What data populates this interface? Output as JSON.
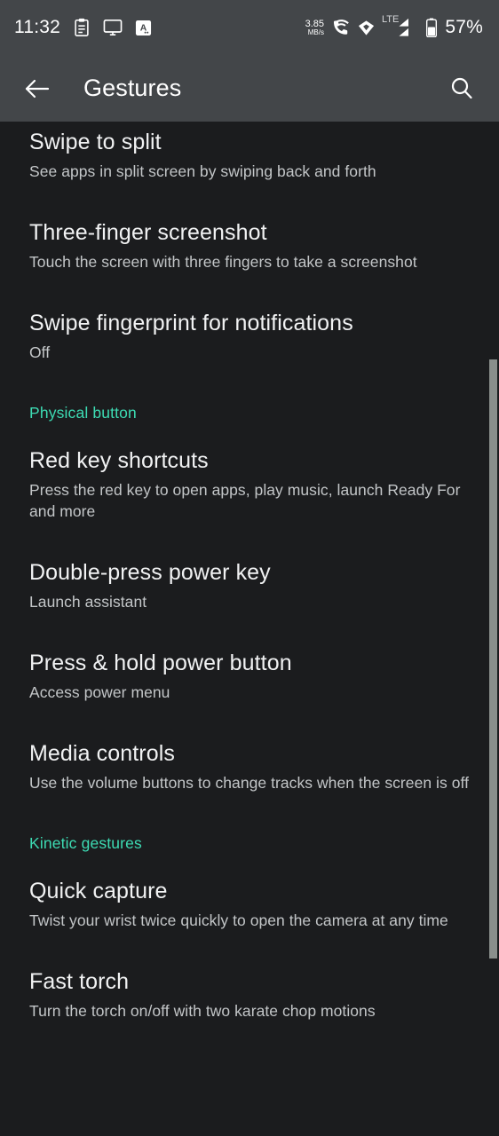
{
  "statusbar": {
    "time": "11:32",
    "icons_left": [
      "clipboard-icon",
      "cast-display-icon",
      "app-badge-a-icon"
    ],
    "network_speed_value": "3.85",
    "network_speed_unit": "MB/s",
    "icons_right": [
      "phone-wifi-calling-icon",
      "vowifi-diamond-icon"
    ],
    "network_type": "LTE",
    "battery_percent": "57%"
  },
  "appbar": {
    "back_icon": "arrow-back-icon",
    "title": "Gestures",
    "search_icon": "search-icon"
  },
  "list": [
    {
      "kind": "item",
      "title": "Swipe to split",
      "subtitle": "See apps in split screen by swiping back and forth"
    },
    {
      "kind": "item",
      "title": "Three-finger screenshot",
      "subtitle": "Touch the screen with three fingers to take a screenshot"
    },
    {
      "kind": "item",
      "title": "Swipe fingerprint for notifications",
      "subtitle": "Off"
    },
    {
      "kind": "section",
      "title": "Physical button"
    },
    {
      "kind": "item",
      "title": "Red key shortcuts",
      "subtitle": "Press the red key to open apps, play music, launch Ready For and more"
    },
    {
      "kind": "item",
      "title": "Double-press power key",
      "subtitle": "Launch assistant"
    },
    {
      "kind": "item",
      "title": "Press & hold power button",
      "subtitle": "Access power menu"
    },
    {
      "kind": "item",
      "title": "Media controls",
      "subtitle": "Use the volume buttons to change tracks when the screen is off"
    },
    {
      "kind": "section",
      "title": "Kinetic gestures"
    },
    {
      "kind": "item",
      "title": "Quick capture",
      "subtitle": "Twist your wrist twice quickly to open the camera at any time"
    },
    {
      "kind": "item",
      "title": "Fast torch",
      "subtitle": "Turn the torch on/off with two karate chop motions"
    }
  ],
  "colors": {
    "accent": "#3ddbb3",
    "appbar_bg": "#434649",
    "page_bg": "#1b1c1e",
    "title_text": "#f1f2f3",
    "subtitle_text": "#c3c6c8",
    "scrollbar": "#8a8f8c"
  }
}
